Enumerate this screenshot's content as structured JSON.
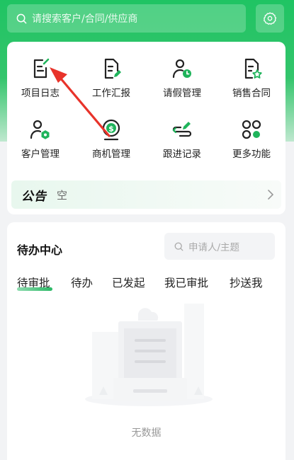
{
  "header": {
    "search_placeholder": "请搜索客户/合同/供应商",
    "accent": "#22c462"
  },
  "menu": {
    "items": [
      {
        "label": "项目日志",
        "icon": "project-log-icon"
      },
      {
        "label": "工作汇报",
        "icon": "work-report-icon"
      },
      {
        "label": "请假管理",
        "icon": "leave-management-icon"
      },
      {
        "label": "销售合同",
        "icon": "sales-contract-icon"
      },
      {
        "label": "客户管理",
        "icon": "customer-management-icon"
      },
      {
        "label": "商机管理",
        "icon": "opportunity-management-icon"
      },
      {
        "label": "跟进记录",
        "icon": "follow-up-record-icon"
      },
      {
        "label": "更多功能",
        "icon": "more-functions-icon"
      }
    ]
  },
  "notice": {
    "logo_text": "公告",
    "text": "空"
  },
  "todo": {
    "title": "待办中心",
    "search_placeholder": "申请人/主题",
    "tabs": [
      "待审批",
      "待办",
      "已发起",
      "我已审批",
      "抄送我"
    ],
    "active_tab": "待审批",
    "empty_text": "无数据"
  }
}
